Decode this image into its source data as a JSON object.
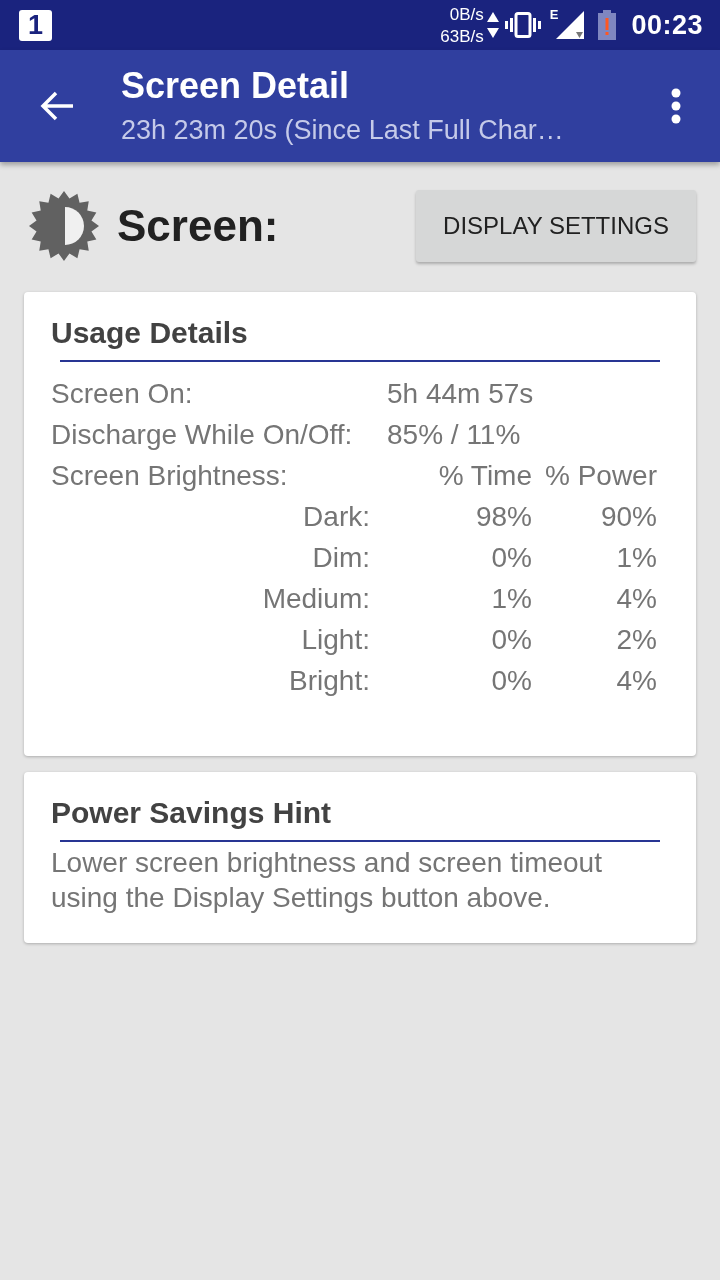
{
  "status_bar": {
    "notification_count": "1",
    "upload_speed": "0B/s",
    "download_speed": "63B/s",
    "network_type": "E",
    "time": "00:23"
  },
  "app_bar": {
    "title": "Screen Detail",
    "subtitle": "23h 23m 20s (Since Last Full Char…"
  },
  "header": {
    "title": "Screen:",
    "button": "DISPLAY SETTINGS"
  },
  "usage_card": {
    "title": "Usage Details",
    "rows": [
      {
        "label": "Screen On:",
        "value": "5h 44m 57s"
      },
      {
        "label": "Discharge While On/Off:",
        "value": "85% / 11%"
      }
    ],
    "brightness": {
      "label": "Screen Brightness:",
      "columns": [
        "% Time",
        "% Power"
      ],
      "rows": [
        {
          "label": "Dark:",
          "time": "98%",
          "power": "90%"
        },
        {
          "label": "Dim:",
          "time": "0%",
          "power": "1%"
        },
        {
          "label": "Medium:",
          "time": "1%",
          "power": "4%"
        },
        {
          "label": "Light:",
          "time": "0%",
          "power": "2%"
        },
        {
          "label": "Bright:",
          "time": "0%",
          "power": "4%"
        }
      ]
    }
  },
  "hint_card": {
    "title": "Power Savings Hint",
    "text": "Lower screen brightness and screen timeout using the Display Settings button above."
  }
}
